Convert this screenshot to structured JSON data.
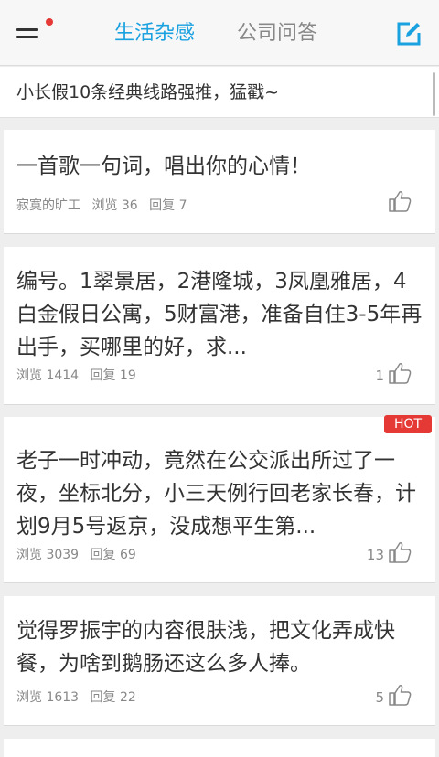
{
  "header": {
    "tab_active": "生活杂感",
    "tab_inactive": "公司问答",
    "accent_color": "#1aa1e0",
    "badge_color": "#e53935"
  },
  "banner": {
    "text": "小长假10条经典线路强推，猛戳~"
  },
  "posts": [
    {
      "title": "一首歌一句词，唱出你的心情！",
      "author": "寂寞的旷工",
      "views_label": "浏览 36",
      "replies_label": "回复 7",
      "likes": ""
    },
    {
      "title": "编号。1翠景居，2港隆城，3凤凰雅居，4白金假日公寓，5财富港，准备自住3-5年再出手，买哪里的好，求...",
      "author": "",
      "views_label": "浏览 1414",
      "replies_label": "回复 19",
      "likes": "1"
    },
    {
      "title": "老子一时冲动，竟然在公交派出所过了一夜，坐标北分，小三天例行回老家长春，计划9月5号返京，没成想平生第...",
      "author": "",
      "views_label": "浏览 3039",
      "replies_label": "回复 69",
      "likes": "13",
      "badge": "HOT"
    },
    {
      "title": "觉得罗振宇的内容很肤浅，把文化弄成快餐，为啥到鹅肠还这么多人捧。",
      "author": "",
      "views_label": "浏览 1613",
      "replies_label": "回复 22",
      "likes": "5"
    }
  ]
}
